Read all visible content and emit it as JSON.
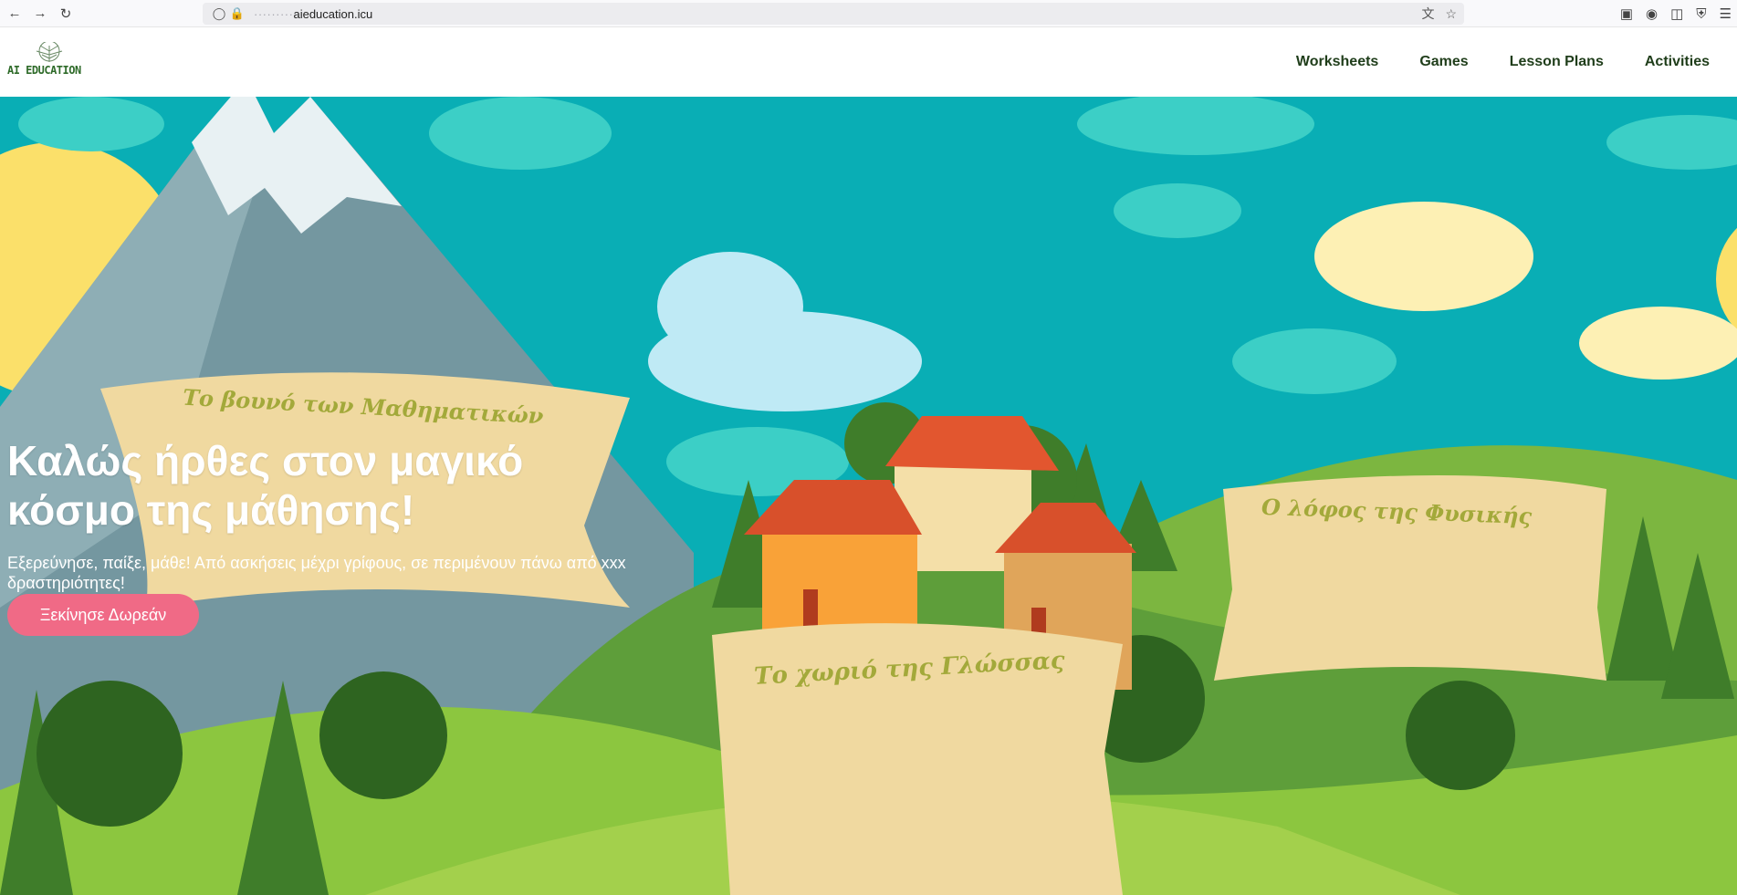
{
  "browser": {
    "url_prefix": "·········",
    "url_domain": "aieducation.icu"
  },
  "site": {
    "logo_text": "AI EDUCATION",
    "nav": [
      "Worksheets",
      "Games",
      "Lesson Plans",
      "Activities"
    ]
  },
  "hero": {
    "title": "Καλώς ήρθες στον μαγικό κόσμο της μάθησης!",
    "subtitle": "Εξερεύνησε, παίξε, μάθε! Από ασκήσεις μέχρι γρίφους, σε περιμένουν πάνω από xxx δραστηριότητες!",
    "cta_label": "Ξεκίνησε Δωρεάν",
    "banners": {
      "math": "Το βουνό των Μαθηματικών",
      "physics": "Ο λόφος της Φυσικής",
      "language": "Το χωριό της Γλώσσας"
    }
  },
  "colors": {
    "sky": "#09aeb5",
    "cta": "#f06a86",
    "nav_text": "#1f3d1a",
    "banner": "#f0d9a0"
  }
}
